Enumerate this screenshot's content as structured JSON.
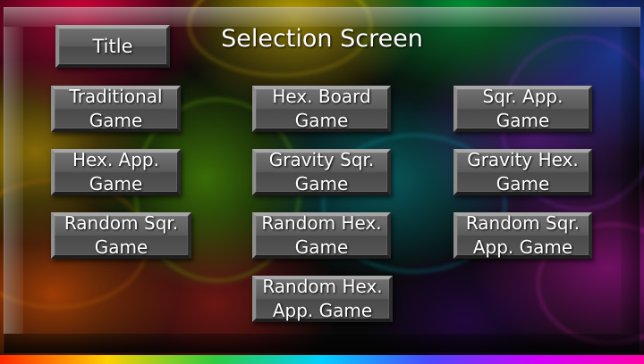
{
  "screen": {
    "title": "Selection Screen"
  },
  "buttons": {
    "title": "Title",
    "traditional_game": "Traditional\nGame",
    "hex_board_game": "Hex. Board\nGame",
    "sqr_app_game": "Sqr. App.\nGame",
    "hex_app_game": "Hex. App.\nGame",
    "gravity_sqr_game": "Gravity Sqr.\nGame",
    "gravity_hex_game": "Gravity Hex.\nGame",
    "random_sqr_game": "Random Sqr.\nGame",
    "random_hex_game": "Random Hex.\nGame",
    "random_sqr_app_game": "Random Sqr.\nApp. Game",
    "random_hex_app_game": "Random Hex.\nApp. Game"
  },
  "colors": {
    "button_face": "#5b5b5b",
    "button_text": "#ffffff",
    "background": "#050505"
  }
}
